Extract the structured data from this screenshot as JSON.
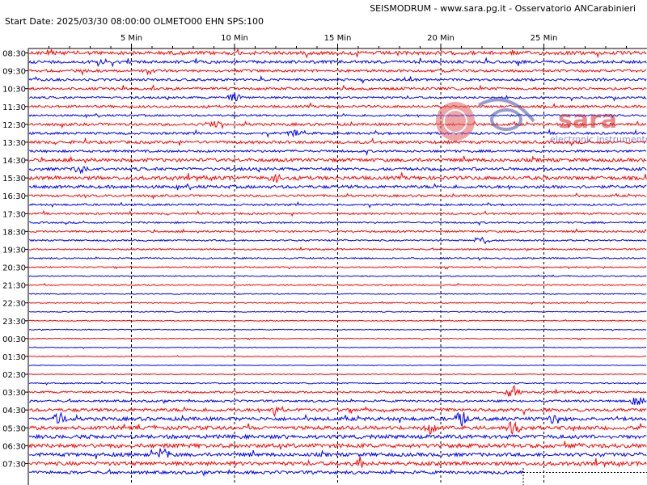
{
  "header": {
    "title": "SEISMODRUM - www.sara.pg.it - Osservatorio ANCarabinieri",
    "start_line": "Start Date: 2025/03/30 08:00:00 OLMETO00 EHN  SPS:100"
  },
  "watermark": {
    "brand": "sara",
    "subtitle": "electronic instruments",
    "seal_text": "Associazione Nazionale Carabinieri",
    "arc_text": "Servizio Volontariato Emergenze"
  },
  "chart_data": {
    "type": "line",
    "title": "SEISMODRUM - www.sara.pg.it - Osservatorio ANCarabinieri",
    "x_ticks": [
      5,
      10,
      15,
      20,
      25
    ],
    "x_tick_labels": [
      "5 Min",
      "10 Min",
      "15 Min",
      "20 Min",
      "25 Min"
    ],
    "xlim": [
      0,
      30
    ],
    "row_labels": [
      "08:30",
      "09:30",
      "10:30",
      "11:30",
      "12:30",
      "13:30",
      "14:30",
      "15:30",
      "16:30",
      "17:30",
      "18:30",
      "19:30",
      "20:30",
      "21:30",
      "22:30",
      "23:30",
      "00:30",
      "01:30",
      "02:30",
      "03:30",
      "04:30",
      "05:30",
      "06:30",
      "07:30"
    ],
    "rows_per_hour": 2,
    "row_colors": [
      "#ff0000",
      "#0000ff"
    ],
    "grid": true,
    "data_end_minute_last_row": 24,
    "events": [
      {
        "row": 0,
        "minute": 1.0,
        "amp": 3
      },
      {
        "row": 1,
        "minute": 3.5,
        "amp": 5
      },
      {
        "row": 5,
        "minute": 10.0,
        "amp": 7
      },
      {
        "row": 8,
        "minute": 9.0,
        "amp": 6
      },
      {
        "row": 9,
        "minute": 13.0,
        "amp": 5
      },
      {
        "row": 13,
        "minute": 2.5,
        "amp": 7
      },
      {
        "row": 14,
        "minute": 12.0,
        "amp": 9
      },
      {
        "row": 21,
        "minute": 22.0,
        "amp": 8
      },
      {
        "row": 38,
        "minute": 23.5,
        "amp": 10
      },
      {
        "row": 39,
        "minute": 29.5,
        "amp": 9
      },
      {
        "row": 40,
        "minute": 12.0,
        "amp": 8
      },
      {
        "row": 41,
        "minute": 1.5,
        "amp": 9
      },
      {
        "row": 41,
        "minute": 21.0,
        "amp": 10
      },
      {
        "row": 41,
        "minute": 25.5,
        "amp": 9
      },
      {
        "row": 42,
        "minute": 19.5,
        "amp": 8
      },
      {
        "row": 42,
        "minute": 23.5,
        "amp": 9
      },
      {
        "row": 45,
        "minute": 6.5,
        "amp": 9
      },
      {
        "row": 46,
        "minute": 16.0,
        "amp": 10
      }
    ],
    "noise_levels": [
      3,
      2.5,
      2.2,
      2.0,
      2.2,
      1.8,
      2.0,
      1.6,
      2.2,
      2.0,
      2.4,
      2.0,
      2.8,
      2.5,
      3.0,
      2.6,
      1.8,
      1.6,
      1.6,
      1.4,
      1.6,
      1.3,
      1.2,
      1.2,
      1.0,
      0.9,
      1.0,
      0.8,
      0.9,
      0.8,
      0.8,
      0.7,
      0.7,
      0.6,
      0.6,
      0.5,
      0.6,
      1.0,
      1.6,
      1.8,
      2.6,
      3.0,
      3.0,
      3.2,
      3.4,
      3.0,
      3.2,
      2.6
    ]
  }
}
